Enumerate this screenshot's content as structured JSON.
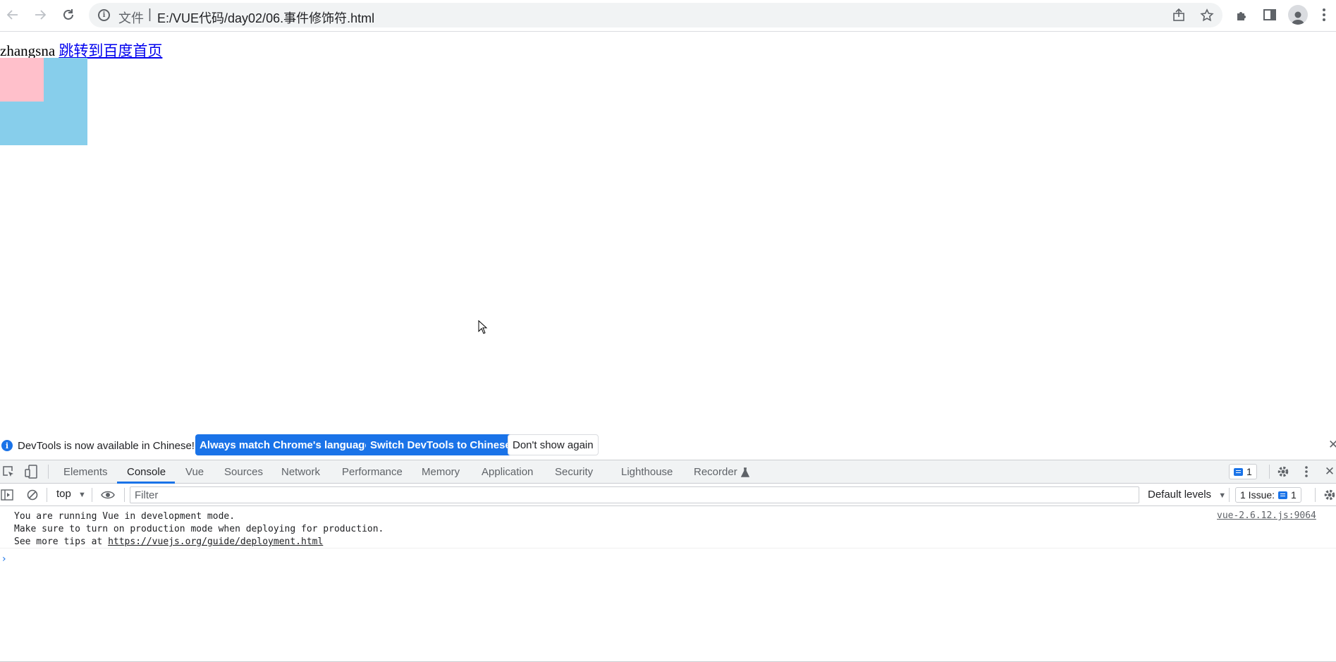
{
  "browser": {
    "address_scheme": "文件",
    "address_separator": "|",
    "address_url": "E:/VUE代码/day02/06.事件修饰符.html"
  },
  "page": {
    "text": "zhangsna",
    "link_text": "跳转到百度首页",
    "colors": {
      "outer_box": "#87ceeb",
      "inner_box": "#ffc0cb"
    }
  },
  "devtools": {
    "infobar": {
      "message": "DevTools is now available in Chinese!",
      "btn_match": "Always match Chrome's language",
      "btn_switch": "Switch DevTools to Chinese",
      "btn_dismiss": "Don't show again"
    },
    "tabs": [
      {
        "label": "Elements"
      },
      {
        "label": "Console"
      },
      {
        "label": "Vue"
      },
      {
        "label": "Sources"
      },
      {
        "label": "Network"
      },
      {
        "label": "Performance"
      },
      {
        "label": "Memory"
      },
      {
        "label": "Application"
      },
      {
        "label": "Security"
      },
      {
        "label": "Lighthouse"
      },
      {
        "label": "Recorder"
      }
    ],
    "active_tab": "Console",
    "issues_badge_count": "1",
    "filter": {
      "context": "top",
      "placeholder": "Filter",
      "levels": "Default levels",
      "issues_label": "1 Issue:",
      "issues_count": "1"
    },
    "console": {
      "line1": "You are running Vue in development mode.",
      "line2": "Make sure to turn on production mode when deploying for production.",
      "line3_prefix": "See more tips at ",
      "line3_link": "https://vuejs.org/guide/deployment.html",
      "source": "vue-2.6.12.js:9064",
      "prompt": "›"
    },
    "accent_color": "#1a73e8"
  }
}
